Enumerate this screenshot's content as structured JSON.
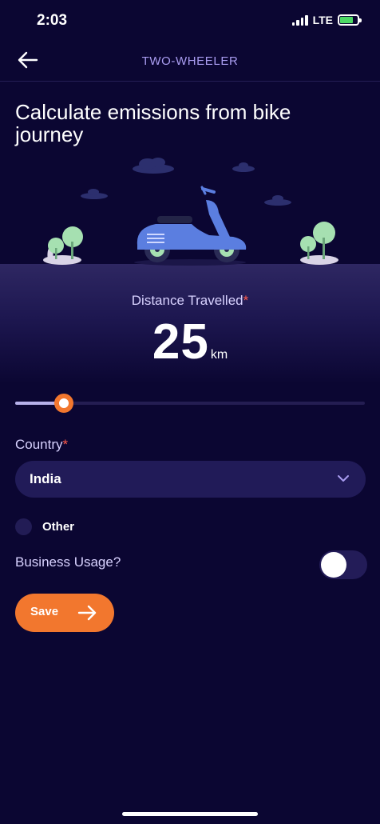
{
  "status_bar": {
    "time": "2:03",
    "network": "LTE",
    "battery_charging": true
  },
  "header": {
    "title": "TWO-WHEELER",
    "back_icon": "arrow-left-icon"
  },
  "page": {
    "title": "Calculate emissions from bike journey"
  },
  "distance": {
    "label": "Distance Travelled",
    "required_mark": "*",
    "value": "25",
    "unit": "km",
    "slider_fraction": 0.14
  },
  "country": {
    "label": "Country",
    "required_mark": "*",
    "selected": "India",
    "chevron_icon": "chevron-down-icon"
  },
  "other_option": {
    "label": "Other",
    "selected": false
  },
  "business_usage": {
    "label": "Business Usage?",
    "enabled": false
  },
  "save_button": {
    "label": "Save",
    "icon": "arrow-right-icon"
  },
  "colors": {
    "background": "#0b0632",
    "accent": "#f2772e",
    "header_title": "#a99cf0",
    "field_bg": "#211b58",
    "required": "#ff5a4a",
    "scooter": "#5b7ee0"
  }
}
